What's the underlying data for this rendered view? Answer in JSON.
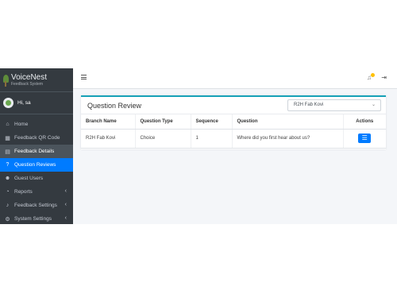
{
  "brand": {
    "name": "VoiceNest",
    "subtitle": "Feedback System"
  },
  "user": {
    "greeting": "Hi, sa"
  },
  "sidebar": {
    "items": [
      {
        "label": "Home",
        "icon": "home-icon"
      },
      {
        "label": "Feedback QR Code",
        "icon": "qr-code-icon"
      },
      {
        "label": "Feedback Details",
        "icon": "document-icon"
      },
      {
        "label": "Question Reviews",
        "icon": "question-circle-icon"
      },
      {
        "label": "Guest Users",
        "icon": "users-icon"
      },
      {
        "label": "Reports",
        "icon": "chart-icon"
      },
      {
        "label": "Feedback Settings",
        "icon": "bell-icon"
      },
      {
        "label": "System Settings",
        "icon": "gears-icon"
      }
    ]
  },
  "header": {
    "menu_icon": "hamburger-icon",
    "notification_icon": "bell-icon",
    "logout_icon": "logout-icon"
  },
  "card": {
    "title": "Question Review",
    "branch_select": {
      "selected": "R2H Fab Kovi"
    }
  },
  "table": {
    "columns": [
      "Branch Name",
      "Question Type",
      "Sequence",
      "Question",
      "Actions"
    ],
    "rows": [
      {
        "branch": "R2H Fab Kovi",
        "type": "Choice",
        "sequence": "1",
        "question": "Where did you first hear about us?",
        "action_icon": "list-icon"
      }
    ]
  },
  "colors": {
    "accent": "#007bff",
    "sidebar_bg": "#343a40",
    "card_border": "#17a2b8",
    "notification": "#ffc107"
  }
}
